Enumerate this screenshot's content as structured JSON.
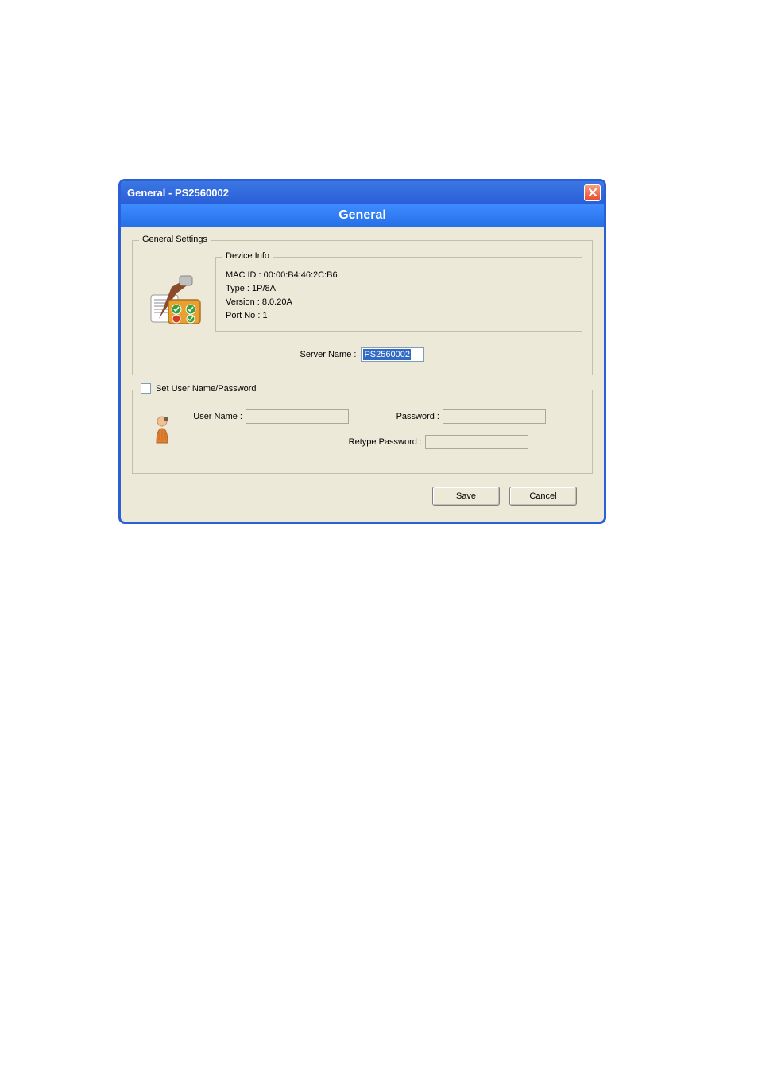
{
  "titlebar": {
    "text": "General - PS2560002"
  },
  "header": {
    "text": "General"
  },
  "generalSettings": {
    "legend": "General Settings",
    "deviceInfo": {
      "legend": "Device Info",
      "macId": "MAC ID : 00:00:B4:46:2C:B6",
      "type": "Type : 1P/8A",
      "version": "Version : 8.0.20A",
      "portNo": "Port No : 1"
    },
    "serverName": {
      "label": "Server Name :",
      "value": "PS2560002"
    }
  },
  "credentials": {
    "checkboxLabel": "Set User Name/Password",
    "userNameLabel": "User Name :",
    "userNameValue": "",
    "passwordLabel": "Password :",
    "passwordValue": "",
    "retypeLabel": "Retype Password :",
    "retypeValue": ""
  },
  "buttons": {
    "save": "Save",
    "cancel": "Cancel"
  }
}
